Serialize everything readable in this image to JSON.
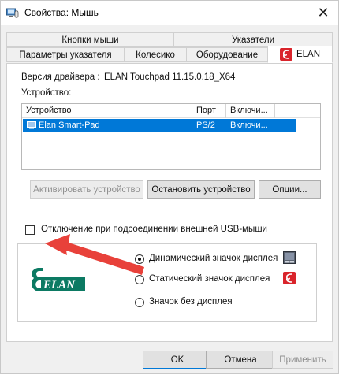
{
  "window": {
    "title": "Свойства: Мышь",
    "close_glyph": "✕"
  },
  "tabs": {
    "top_row": [
      "Кнопки мыши",
      "Указатели"
    ],
    "bottom_row": [
      "Параметры указателя",
      "Колесико",
      "Оборудование",
      "ELAN"
    ],
    "active": "ELAN"
  },
  "elan_panel": {
    "driver_label": "Версия драйвера :",
    "driver_value": "ELAN Touchpad 11.15.0.18_X64",
    "devices_label": "Устройство:",
    "list": {
      "columns": [
        "Устройство",
        "Порт",
        "Включи..."
      ],
      "rows": [
        {
          "device": "Elan Smart-Pad",
          "port": "PS/2",
          "enabled": "Включи..."
        }
      ],
      "selected_color": "#0078d7"
    },
    "buttons": {
      "activate": "Активировать устройство",
      "stop": "Остановить устройство",
      "options": "Опции..."
    },
    "usb_checkbox": {
      "label": "Отключение при подсоединении внешней USB-мыши",
      "checked": false
    },
    "logo_text": "ELAN",
    "display_options": [
      {
        "label": "Динамический значок дисплея",
        "checked": true,
        "icon": "touchpad-icon"
      },
      {
        "label": "Статический значок дисплея",
        "checked": false,
        "icon": "elan-tray-icon"
      },
      {
        "label": "Значок без дисплея",
        "checked": false,
        "icon": ""
      }
    ]
  },
  "footer": {
    "ok": "OK",
    "cancel": "Отмена",
    "apply": "Применить"
  },
  "colors": {
    "accent": "#0078d7",
    "annotation_arrow": "#e8413a",
    "elan_logo": "#0c7a63",
    "elan_badge": "#d9242b"
  }
}
